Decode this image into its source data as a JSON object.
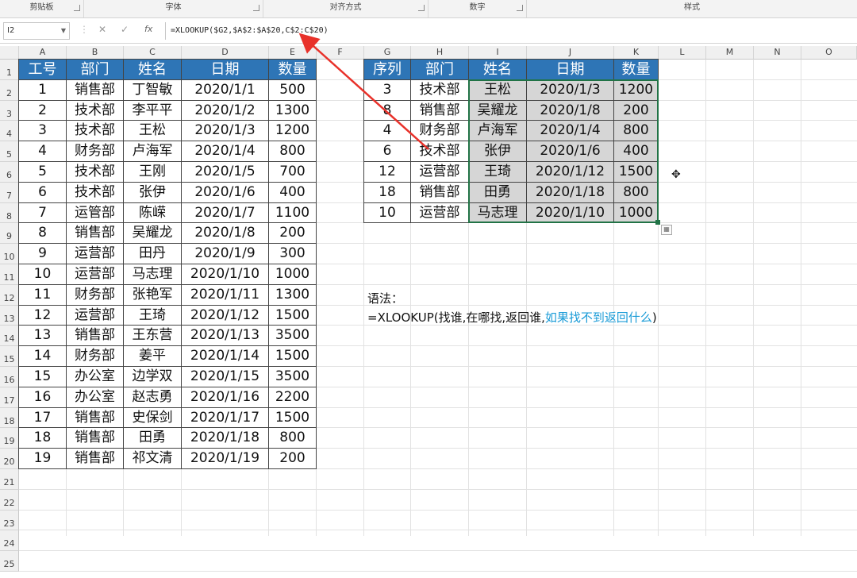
{
  "ribbon": {
    "groups": [
      "剪贴板",
      "字体",
      "对齐方式",
      "数字",
      "样式"
    ]
  },
  "formula_bar": {
    "name_box": "I2",
    "cancel_icon": "✕",
    "confirm_icon": "✓",
    "fx_label": "fx",
    "formula": "=XLOOKUP($G2,$A$2:$A$20,C$2:C$20)"
  },
  "columns": [
    "A",
    "B",
    "C",
    "D",
    "E",
    "F",
    "G",
    "H",
    "I",
    "J",
    "K",
    "L",
    "M",
    "N",
    "O"
  ],
  "rows": [
    "1",
    "2",
    "3",
    "4",
    "5",
    "6",
    "7",
    "8",
    "9",
    "10",
    "11",
    "12",
    "13",
    "14",
    "15",
    "16",
    "17",
    "18",
    "19",
    "20",
    "21",
    "22",
    "23",
    "24",
    "25"
  ],
  "table1": {
    "headers": [
      "工号",
      "部门",
      "姓名",
      "日期",
      "数量"
    ],
    "rows": [
      [
        "1",
        "销售部",
        "丁智敏",
        "2020/1/1",
        "500"
      ],
      [
        "2",
        "技术部",
        "李平平",
        "2020/1/2",
        "1300"
      ],
      [
        "3",
        "技术部",
        "王松",
        "2020/1/3",
        "1200"
      ],
      [
        "4",
        "财务部",
        "卢海军",
        "2020/1/4",
        "800"
      ],
      [
        "5",
        "技术部",
        "王刚",
        "2020/1/5",
        "700"
      ],
      [
        "6",
        "技术部",
        "张伊",
        "2020/1/6",
        "400"
      ],
      [
        "7",
        "运管部",
        "陈嵘",
        "2020/1/7",
        "1100"
      ],
      [
        "8",
        "销售部",
        "吴耀龙",
        "2020/1/8",
        "200"
      ],
      [
        "9",
        "运营部",
        "田丹",
        "2020/1/9",
        "300"
      ],
      [
        "10",
        "运营部",
        "马志理",
        "2020/1/10",
        "1000"
      ],
      [
        "11",
        "财务部",
        "张艳军",
        "2020/1/11",
        "1300"
      ],
      [
        "12",
        "运营部",
        "王琦",
        "2020/1/12",
        "1500"
      ],
      [
        "13",
        "销售部",
        "王东营",
        "2020/1/13",
        "3500"
      ],
      [
        "14",
        "财务部",
        "姜平",
        "2020/1/14",
        "1500"
      ],
      [
        "15",
        "办公室",
        "边学双",
        "2020/1/15",
        "3500"
      ],
      [
        "16",
        "办公室",
        "赵志勇",
        "2020/1/16",
        "2200"
      ],
      [
        "17",
        "销售部",
        "史保剑",
        "2020/1/17",
        "1500"
      ],
      [
        "18",
        "销售部",
        "田勇",
        "2020/1/18",
        "800"
      ],
      [
        "19",
        "销售部",
        "祁文清",
        "2020/1/19",
        "200"
      ]
    ]
  },
  "table2": {
    "headers": [
      "序列",
      "部门",
      "姓名",
      "日期",
      "数量"
    ],
    "rows": [
      [
        "3",
        "技术部",
        "王松",
        "2020/1/3",
        "1200"
      ],
      [
        "8",
        "销售部",
        "吴耀龙",
        "2020/1/8",
        "200"
      ],
      [
        "4",
        "财务部",
        "卢海军",
        "2020/1/4",
        "800"
      ],
      [
        "6",
        "技术部",
        "张伊",
        "2020/1/6",
        "400"
      ],
      [
        "12",
        "运营部",
        "王琦",
        "2020/1/12",
        "1500"
      ],
      [
        "18",
        "销售部",
        "田勇",
        "2020/1/18",
        "800"
      ],
      [
        "10",
        "运营部",
        "马志理",
        "2020/1/10",
        "1000"
      ]
    ]
  },
  "syntax": {
    "title": "语法：",
    "formula_prefix": "=XLOOKUP(找谁,在哪找,返回谁,",
    "formula_highlight": "如果找不到返回什么",
    "formula_suffix": ")"
  },
  "colors": {
    "header_bg": "#2e75b6",
    "selection_bg": "#d6d6d6",
    "highlight_text": "#1a9bd7",
    "arrow": "#e8312a"
  }
}
